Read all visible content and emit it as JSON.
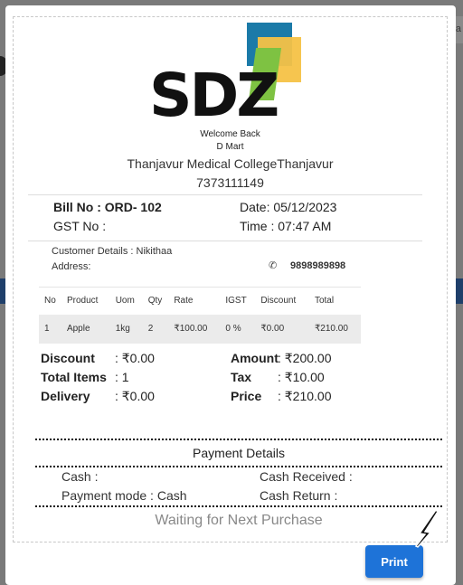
{
  "background": {
    "right_text": "la"
  },
  "receipt": {
    "logo_text": "SDZ",
    "welcome": "Welcome Back",
    "shop_name": "D Mart",
    "address": "Thanjavur Medical CollegeThanjavur",
    "phone": "7373111149",
    "bill_no": "Bill No : ORD- 102",
    "date": "Date: 05/12/2023",
    "gst": "GST No :",
    "time": "Time : 07:47 AM",
    "customer": "Customer Details : Nikithaa",
    "customer_address": "Address:",
    "customer_phone": "9898989898",
    "table": {
      "headers": [
        "No",
        "Product",
        "Uom",
        "Qty",
        "Rate",
        "IGST",
        "Discount",
        "Total"
      ],
      "rows": [
        [
          "1",
          "Apple",
          "1kg",
          "2",
          "₹100.00",
          "0 %",
          "₹0.00",
          "₹210.00"
        ]
      ]
    },
    "summary": {
      "discount_label": "Discount",
      "discount_value": ": ₹0.00",
      "total_items_label": "Total Items",
      "total_items_value": ": 1",
      "delivery_label": "Delivery",
      "delivery_value": ": ₹0.00",
      "amount_label": "Amount",
      "amount_value": ": ₹200.00",
      "tax_label": "Tax",
      "tax_value": ": ₹10.00",
      "price_label": "Price",
      "price_value": ": ₹210.00"
    },
    "payment": {
      "title": "Payment Details",
      "cash": "Cash :",
      "cash_received": "Cash Received :",
      "mode": "Payment mode : Cash",
      "cash_return": "Cash Return :"
    },
    "footer": "Waiting for Next Purchase"
  },
  "actions": {
    "print_label": "Print"
  },
  "colors": {
    "print_button": "#1e73d8",
    "logo_blue": "#1b7aa8",
    "logo_yellow": "#f5c246",
    "logo_green": "#7ec242"
  }
}
